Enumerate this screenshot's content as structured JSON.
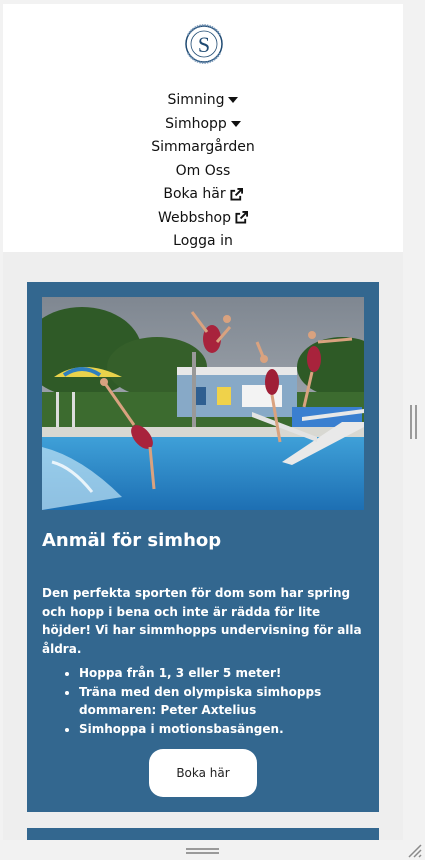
{
  "logo": {
    "icon": "swim-club-logo",
    "letter": "S"
  },
  "nav": {
    "items": [
      {
        "label": "Simning",
        "icon": "caret-down-icon"
      },
      {
        "label": "Simhopp",
        "icon": "caret-down-icon"
      },
      {
        "label": "Simmargården",
        "icon": ""
      },
      {
        "label": "Om Oss",
        "icon": ""
      },
      {
        "label": "Boka här",
        "icon": "external-link-icon"
      },
      {
        "label": "Webbshop",
        "icon": "external-link-icon"
      },
      {
        "label": "Logga in",
        "icon": ""
      }
    ]
  },
  "card": {
    "title": "Anmäl för simhop",
    "text": "Den perfekta sporten för dom som har spring och hopp i bena och inte är rädda för lite höjder! Vi har simmhopps undervisning för alla åldra.",
    "list": [
      "Hoppa från 1, 3 eller 5 meter!",
      "Träna med den olympiska simhopps dommaren: Peter Axtelius",
      "Simhoppa i motionsbasängen."
    ],
    "button_label": "Boka här"
  },
  "colors": {
    "card_bg": "#33678f",
    "header_bg": "#ffffff",
    "page_bg": "#eeeeee"
  }
}
